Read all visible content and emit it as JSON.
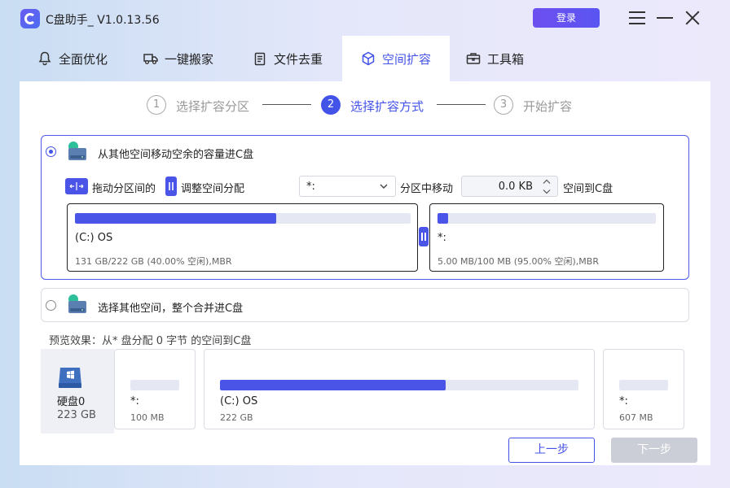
{
  "app": {
    "title": "C盘助手_ V1.0.13.56",
    "login_label": "登录"
  },
  "tabs": [
    {
      "label": "全面优化",
      "icon": "bell-icon",
      "active": false
    },
    {
      "label": "一键搬家",
      "icon": "truck-icon",
      "active": false
    },
    {
      "label": "文件去重",
      "icon": "document-icon",
      "active": false
    },
    {
      "label": "空间扩容",
      "icon": "cube-icon",
      "active": true
    },
    {
      "label": "工具箱",
      "icon": "toolbox-icon",
      "active": false
    }
  ],
  "steps": [
    {
      "num": "1",
      "label": "选择扩容分区",
      "state": "done"
    },
    {
      "num": "2",
      "label": "选择扩容方式",
      "state": "active"
    },
    {
      "num": "3",
      "label": "开始扩容",
      "state": "pending"
    }
  ],
  "option1": {
    "label": "从其他空间移动空余的容量进C盘",
    "selected": true,
    "drag_text": "拖动分区间的",
    "adjust_text": "调整空间分配",
    "source_select": "*:",
    "move_text": "分区中移动",
    "amount": "0.0 KB",
    "to_text": "空间到C盘",
    "left_partition": {
      "name": "(C:) OS",
      "info": "131 GB/222 GB (40.00% 空闲),MBR",
      "used_fraction": 0.6
    },
    "right_partition": {
      "name": "*:",
      "info": "5.00 MB/100 MB (95.00% 空闲),MBR",
      "used_fraction": 0.05
    }
  },
  "option2": {
    "label": "选择其他空间，整个合并进C盘",
    "selected": false
  },
  "preview": {
    "label": "预览效果：从* 盘分配 0 字节 的空间到C盘",
    "disk": {
      "name": "硬盘0",
      "size": "223 GB"
    },
    "partitions": [
      {
        "name": "*:",
        "size": "100 MB",
        "used_fraction": 0.0
      },
      {
        "name": "(C:) OS",
        "size": "222 GB",
        "used_fraction": 0.63
      },
      {
        "name": "*:",
        "size": "607 MB",
        "used_fraction": 0.0
      }
    ]
  },
  "buttons": {
    "prev": "上一步",
    "next": "下一步"
  },
  "colors": {
    "accent": "#4353e8",
    "bar_fill": "#4a55e8",
    "bar_track": "#e5e8f3",
    "disabled": "#cbced6"
  }
}
